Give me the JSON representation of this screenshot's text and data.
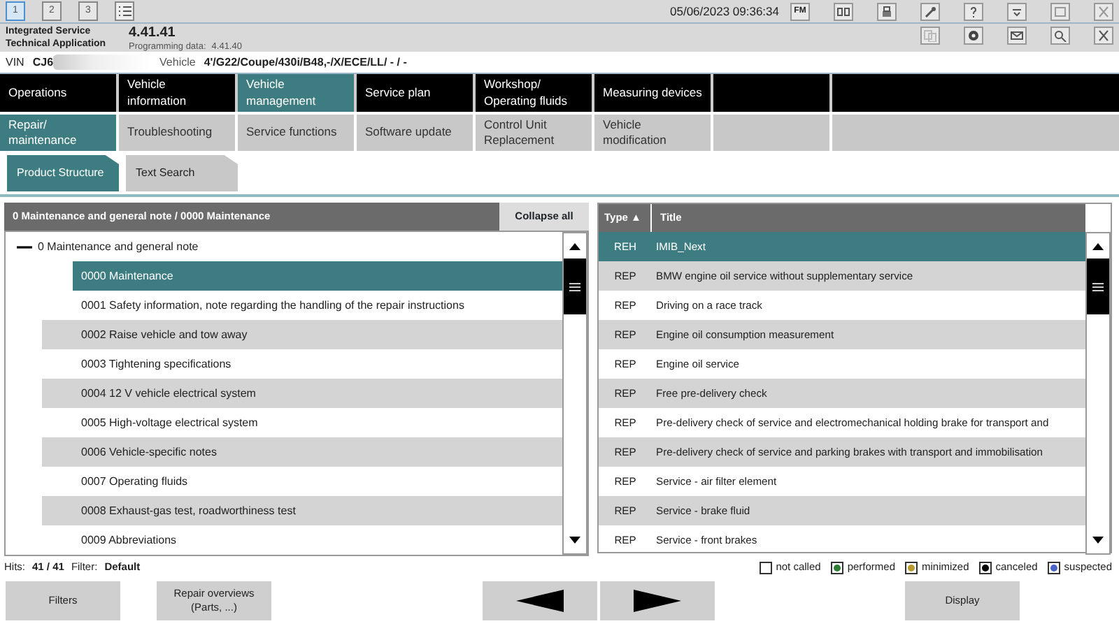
{
  "session_tabs": [
    {
      "label": "1",
      "selected": true
    },
    {
      "label": "2",
      "selected": false
    },
    {
      "label": "3",
      "selected": false
    }
  ],
  "datetime": "05/06/2023 09:36:34",
  "fm_label": "FM",
  "app": {
    "title": "Integrated Service Technical Application",
    "version": "4.41.41",
    "programming_label": "Programming data:",
    "programming_value": "4.41.40"
  },
  "vehicle_bar": {
    "vin_label": "VIN",
    "vin": "CJ6",
    "vehicle_label": "Vehicle",
    "vehicle": "4'/G22/Coupe/430i/B48,-/X/ECE/LL/ - / -"
  },
  "main_nav": [
    {
      "label": "Operations",
      "selected": false
    },
    {
      "label": "Vehicle information",
      "selected": false
    },
    {
      "label": "Vehicle management",
      "selected": true
    },
    {
      "label": "Service plan",
      "selected": false
    },
    {
      "label": "Workshop/ Operating fluids",
      "selected": false
    },
    {
      "label": "Measuring devices",
      "selected": false
    }
  ],
  "sub_nav": [
    {
      "label": "Repair/ maintenance",
      "selected": true
    },
    {
      "label": "Troubleshooting",
      "selected": false
    },
    {
      "label": "Service functions",
      "selected": false
    },
    {
      "label": "Software update",
      "selected": false
    },
    {
      "label": "Control Unit Replacement",
      "selected": false
    },
    {
      "label": "Vehicle modification",
      "selected": false
    }
  ],
  "view_tabs": [
    {
      "label": "Product Structure",
      "selected": true
    },
    {
      "label": "Text Search",
      "selected": false
    }
  ],
  "tree_panel": {
    "breadcrumb": "0 Maintenance and general note / 0000 Maintenance",
    "collapse_button": "Collapse all",
    "items": [
      {
        "label": "0 Maintenance and general note",
        "expanded": true,
        "selected": false,
        "children": [
          {
            "label": "0000 Maintenance",
            "selected": true
          },
          {
            "label": "0001 Safety information, note regarding the handling of the repair instructions",
            "selected": false
          },
          {
            "label": "0002 Raise vehicle and tow away",
            "selected": false
          },
          {
            "label": "0003 Tightening specifications",
            "selected": false
          },
          {
            "label": "0004 12 V vehicle electrical system",
            "selected": false
          },
          {
            "label": "0005 High-voltage electrical system",
            "selected": false
          },
          {
            "label": "0006 Vehicle-specific notes",
            "selected": false
          },
          {
            "label": "0007 Operating fluids",
            "selected": false
          },
          {
            "label": "0008 Exhaust-gas test, roadworthiness test",
            "selected": false
          },
          {
            "label": "0009 Abbreviations",
            "selected": false
          }
        ]
      }
    ]
  },
  "document_table": {
    "columns": [
      {
        "label": "Type ▲"
      },
      {
        "label": "Title"
      }
    ],
    "rows": [
      {
        "type": "REH",
        "title": "IMIB_Next",
        "selected": true
      },
      {
        "type": "REP",
        "title": "BMW engine oil service without supplementary service",
        "selected": false
      },
      {
        "type": "REP",
        "title": "Driving on a race track",
        "selected": false
      },
      {
        "type": "REP",
        "title": "Engine oil consumption measurement",
        "selected": false
      },
      {
        "type": "REP",
        "title": "Engine oil service",
        "selected": false
      },
      {
        "type": "REP",
        "title": "Free pre-delivery check",
        "selected": false
      },
      {
        "type": "REP",
        "title": "Pre-delivery check of service and electromechanical holding brake for transport and",
        "selected": false
      },
      {
        "type": "REP",
        "title": "Pre-delivery check of service and parking brakes with transport and immobilisation",
        "selected": false
      },
      {
        "type": "REP",
        "title": "Service - air filter element",
        "selected": false
      },
      {
        "type": "REP",
        "title": "Service - brake fluid",
        "selected": false
      },
      {
        "type": "REP",
        "title": "Service - front brakes",
        "selected": false
      }
    ]
  },
  "status": {
    "hits_label": "Hits:",
    "hits": "41 / 41",
    "filter_label": "Filter:",
    "filter": "Default"
  },
  "legend": [
    {
      "label": "not called",
      "color": "#ffffff"
    },
    {
      "label": "performed",
      "color": "#2e7d32"
    },
    {
      "label": "minimized",
      "color": "#b89a2e"
    },
    {
      "label": "canceled",
      "color": "#000000"
    },
    {
      "label": "suspected",
      "color": "#4a64c8"
    }
  ],
  "buttons": [
    {
      "kind": "text",
      "label": "Filters"
    },
    {
      "kind": "text",
      "label": "Repair overviews (Parts, ...)"
    },
    {
      "kind": "back"
    },
    {
      "kind": "forward"
    },
    {
      "kind": "text",
      "label": "Display"
    }
  ]
}
